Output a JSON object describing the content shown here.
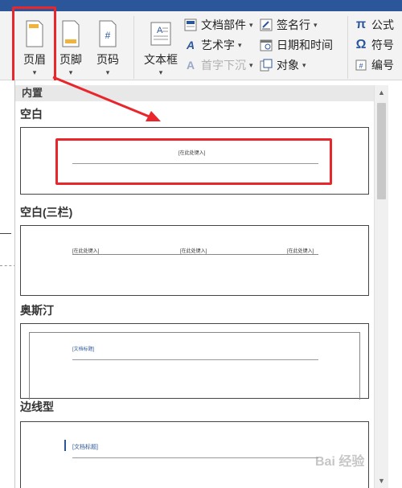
{
  "ribbon": {
    "header_label": "页眉",
    "footer_label": "页脚",
    "page_number_label": "页码",
    "textbox_label": "文本框",
    "quick_parts_label": "文档部件",
    "wordart_label": "艺术字",
    "dropcap_label": "首字下沉",
    "signature_label": "签名行",
    "datetime_label": "日期和时间",
    "object_label": "对象",
    "equation_label": "公式",
    "symbol_label": "符号",
    "number_label": "编号"
  },
  "gallery": {
    "builtin_label": "内置",
    "sections": [
      {
        "title": "空白",
        "placeholders": [
          "[在此处键入]"
        ]
      },
      {
        "title": "空白(三栏)",
        "placeholders": [
          "[在此处键入]",
          "[在此处键入]",
          "[在此处键入]"
        ]
      },
      {
        "title": "奥斯汀",
        "placeholders": [
          "[文档标题]"
        ]
      },
      {
        "title": "边线型",
        "placeholders": [
          "[文档标题]"
        ]
      }
    ]
  },
  "colors": {
    "highlight": "#e8262b",
    "accent": "#2b579a"
  },
  "watermark": "Bai 经验"
}
